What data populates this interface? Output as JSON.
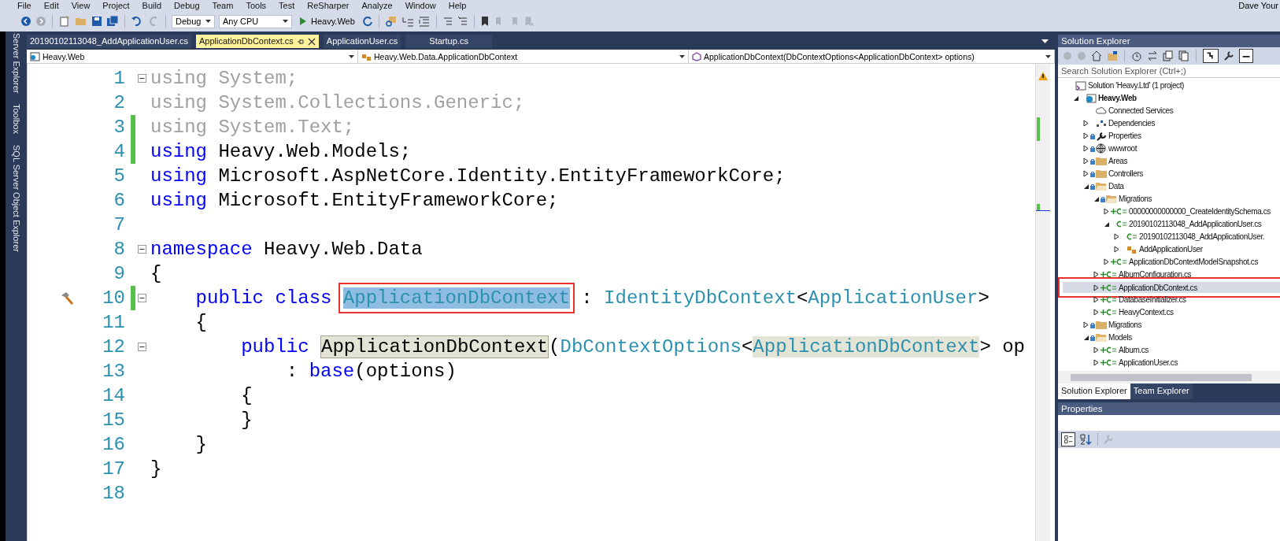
{
  "menu": [
    "File",
    "Edit",
    "View",
    "Project",
    "Build",
    "Debug",
    "Team",
    "Tools",
    "Test",
    "ReSharper",
    "Analyze",
    "Window",
    "Help"
  ],
  "user": "Dave Your",
  "toolbar": {
    "configuration": "Debug",
    "platform": "Any CPU",
    "run_target": "Heavy.Web"
  },
  "side_tabs": [
    "Server Explorer",
    "Toolbox",
    "SQL Server Object Explorer"
  ],
  "tabs": [
    {
      "label": "20190102113048_AddApplicationUser.cs",
      "selected": false
    },
    {
      "label": "ApplicationDbContext.cs",
      "selected": true
    },
    {
      "label": "ApplicationUser.cs",
      "selected": false
    },
    {
      "label": "Startup.cs",
      "selected": false
    }
  ],
  "nav_bar": {
    "project": "Heavy.Web",
    "type": "Heavy.Web.Data.ApplicationDbContext",
    "member": "ApplicationDbContext(DbContextOptions<ApplicationDbContext> options)"
  },
  "code": {
    "lines": [
      {
        "number": "1",
        "changed": false,
        "collapsible": true,
        "tokens": [
          {
            "text": "using System;",
            "kind": "dim"
          }
        ]
      },
      {
        "number": "2",
        "changed": false,
        "collapsible": false,
        "tokens": [
          {
            "text": "using System.Collections.Generic;",
            "kind": "dim"
          }
        ]
      },
      {
        "number": "3",
        "changed": true,
        "collapsible": false,
        "tokens": [
          {
            "text": "using System.Text;",
            "kind": "dim"
          }
        ]
      },
      {
        "number": "4",
        "changed": true,
        "collapsible": false,
        "tokens": [
          {
            "text": "using",
            "kind": "kw"
          },
          {
            "text": " Heavy.Web.Models;",
            "kind": "plain"
          }
        ]
      },
      {
        "number": "5",
        "changed": false,
        "collapsible": false,
        "tokens": [
          {
            "text": "using",
            "kind": "kw"
          },
          {
            "text": " Microsoft.AspNetCore.Identity.EntityFrameworkCore;",
            "kind": "plain"
          }
        ]
      },
      {
        "number": "6",
        "changed": false,
        "collapsible": false,
        "tokens": [
          {
            "text": "using",
            "kind": "kw"
          },
          {
            "text": " Microsoft.EntityFrameworkCore;",
            "kind": "plain"
          }
        ]
      },
      {
        "number": "7",
        "changed": false,
        "collapsible": false
      },
      {
        "number": "8",
        "changed": false,
        "collapsible": true,
        "tokens": [
          {
            "text": "namespace",
            "kind": "kw"
          },
          {
            "text": " Heavy.Web.Data",
            "kind": "plain"
          }
        ]
      },
      {
        "number": "9",
        "changed": false,
        "collapsible": false,
        "tokens": [
          {
            "text": "{",
            "kind": "plain"
          }
        ]
      },
      {
        "number": "10",
        "changed": true,
        "collapsible": true,
        "tokens": [
          {
            "text": "    public class ",
            "kind": "kw"
          },
          {
            "text": "ApplicationDbContext",
            "kind": "sel"
          },
          {
            "text": " : ",
            "kind": "plain"
          },
          {
            "text": "IdentityDbContext",
            "kind": "type"
          },
          {
            "text": "<",
            "kind": "plain"
          },
          {
            "text": "ApplicationUser",
            "kind": "type"
          },
          {
            "text": ">",
            "kind": "plain"
          }
        ]
      },
      {
        "number": "11",
        "changed": false,
        "collapsible": false,
        "tokens": [
          {
            "text": "    {",
            "kind": "plain"
          }
        ]
      },
      {
        "number": "12",
        "changed": false,
        "collapsible": true,
        "tokens": [
          {
            "text": "        public ",
            "kind": "kw"
          },
          {
            "text": "ApplicationDbContext",
            "kind": "ref"
          },
          {
            "text": "(",
            "kind": "plain"
          },
          {
            "text": "DbContextOptions",
            "kind": "type"
          },
          {
            "text": "<",
            "kind": "plain"
          },
          {
            "text": "ApplicationDbContext",
            "kind": "reftype"
          },
          {
            "text": "> op",
            "kind": "plain"
          }
        ]
      },
      {
        "number": "13",
        "changed": false,
        "collapsible": false,
        "tokens": [
          {
            "text": "            : ",
            "kind": "plain"
          },
          {
            "text": "base",
            "kind": "kw"
          },
          {
            "text": "(options)",
            "kind": "plain"
          }
        ]
      },
      {
        "number": "14",
        "changed": false,
        "collapsible": false,
        "tokens": [
          {
            "text": "        {",
            "kind": "plain"
          }
        ]
      },
      {
        "number": "15",
        "changed": false,
        "collapsible": false,
        "tokens": [
          {
            "text": "        }",
            "kind": "plain"
          }
        ]
      },
      {
        "number": "16",
        "changed": false,
        "collapsible": false,
        "tokens": [
          {
            "text": "    }",
            "kind": "plain"
          }
        ]
      },
      {
        "number": "17",
        "changed": false,
        "collapsible": false,
        "tokens": [
          {
            "text": "}",
            "kind": "plain"
          }
        ]
      },
      {
        "number": "18",
        "changed": false,
        "collapsible": false
      }
    ]
  },
  "solution_explorer": {
    "title": "Solution Explorer",
    "search": {
      "placeholder": "Search Solution Explorer (Ctrl+;)"
    },
    "tree": [
      {
        "label": "Solution 'Heavy.Ltd' (1 project)",
        "kind": "solution",
        "selected": false,
        "children": [
          {
            "label": "Heavy.Web",
            "kind": "project",
            "startup": true,
            "locked": false,
            "added": false,
            "expanded": true,
            "selected": false,
            "children": [
              {
                "label": "Connected Services",
                "kind": "service",
                "locked": false,
                "added": false,
                "selected": false
              },
              {
                "label": "Dependencies",
                "kind": "dependencies",
                "locked": false,
                "added": false,
                "expanded": false,
                "selected": false
              },
              {
                "label": "Properties",
                "kind": "properties",
                "locked": true,
                "added": false,
                "expanded": false,
                "selected": false
              },
              {
                "label": "wwwroot",
                "kind": "webroot",
                "locked": true,
                "added": false,
                "expanded": false,
                "selected": false
              },
              {
                "label": "Areas",
                "kind": "folder",
                "locked": true,
                "added": false,
                "expanded": false,
                "selected": false
              },
              {
                "label": "Controllers",
                "kind": "folder",
                "locked": true,
                "added": false,
                "expanded": false,
                "selected": false
              },
              {
                "label": "Data",
                "kind": "folder",
                "locked": true,
                "added": false,
                "expanded": true,
                "selected": false,
                "children": [
                  {
                    "label": "Migrations",
                    "kind": "folder",
                    "locked": true,
                    "added": false,
                    "expanded": true,
                    "selected": false,
                    "children": [
                      {
                        "label": "00000000000000_CreateIdentitySchema.cs",
                        "kind": "file",
                        "locked": false,
                        "added": true,
                        "expanded": false,
                        "selected": false
                      },
                      {
                        "label": "20190102113048_AddApplicationUser.cs",
                        "kind": "file",
                        "locked": false,
                        "added": false,
                        "expanded": true,
                        "selected": false,
                        "children": [
                          {
                            "label": "20190102113048_AddApplicationUser.",
                            "kind": "file",
                            "locked": false,
                            "added": false,
                            "expanded": false,
                            "selected": false
                          },
                          {
                            "label": "AddApplicationUser",
                            "kind": "class",
                            "locked": false,
                            "added": false,
                            "expanded": false,
                            "selected": false
                          }
                        ]
                      },
                      {
                        "label": "ApplicationDbContextModelSnapshot.cs",
                        "kind": "file",
                        "locked": false,
                        "added": true,
                        "expanded": false,
                        "selected": false
                      }
                    ]
                  },
                  {
                    "label": "AlbumConfiguration.cs",
                    "kind": "file",
                    "locked": false,
                    "added": true,
                    "expanded": false,
                    "selected": false
                  },
                  {
                    "label": "ApplicationDbContext.cs",
                    "kind": "file",
                    "locked": false,
                    "added": true,
                    "expanded": false,
                    "selected": true
                  },
                  {
                    "label": "DatabaseInitializer.cs",
                    "kind": "file",
                    "locked": false,
                    "added": true,
                    "expanded": false,
                    "selected": false
                  },
                  {
                    "label": "HeavyContext.cs",
                    "kind": "file",
                    "locked": false,
                    "added": true,
                    "expanded": false,
                    "selected": false
                  }
                ]
              },
              {
                "label": "Migrations",
                "kind": "folder",
                "locked": true,
                "added": false,
                "expanded": false,
                "selected": false
              },
              {
                "label": "Models",
                "kind": "folder",
                "locked": true,
                "added": false,
                "expanded": true,
                "selected": false,
                "children": [
                  {
                    "label": "Album.cs",
                    "kind": "file",
                    "locked": false,
                    "added": true,
                    "expanded": false,
                    "selected": false
                  },
                  {
                    "label": "ApplicationUser.cs",
                    "kind": "file",
                    "locked": false,
                    "added": true,
                    "expanded": false,
                    "selected": false
                  }
                ]
              }
            ]
          }
        ]
      }
    ],
    "bottom_tabs": [
      {
        "label": "Solution Explorer",
        "selected": true
      },
      {
        "label": "Team Explorer",
        "selected": false
      }
    ]
  },
  "properties": {
    "title": "Properties"
  }
}
